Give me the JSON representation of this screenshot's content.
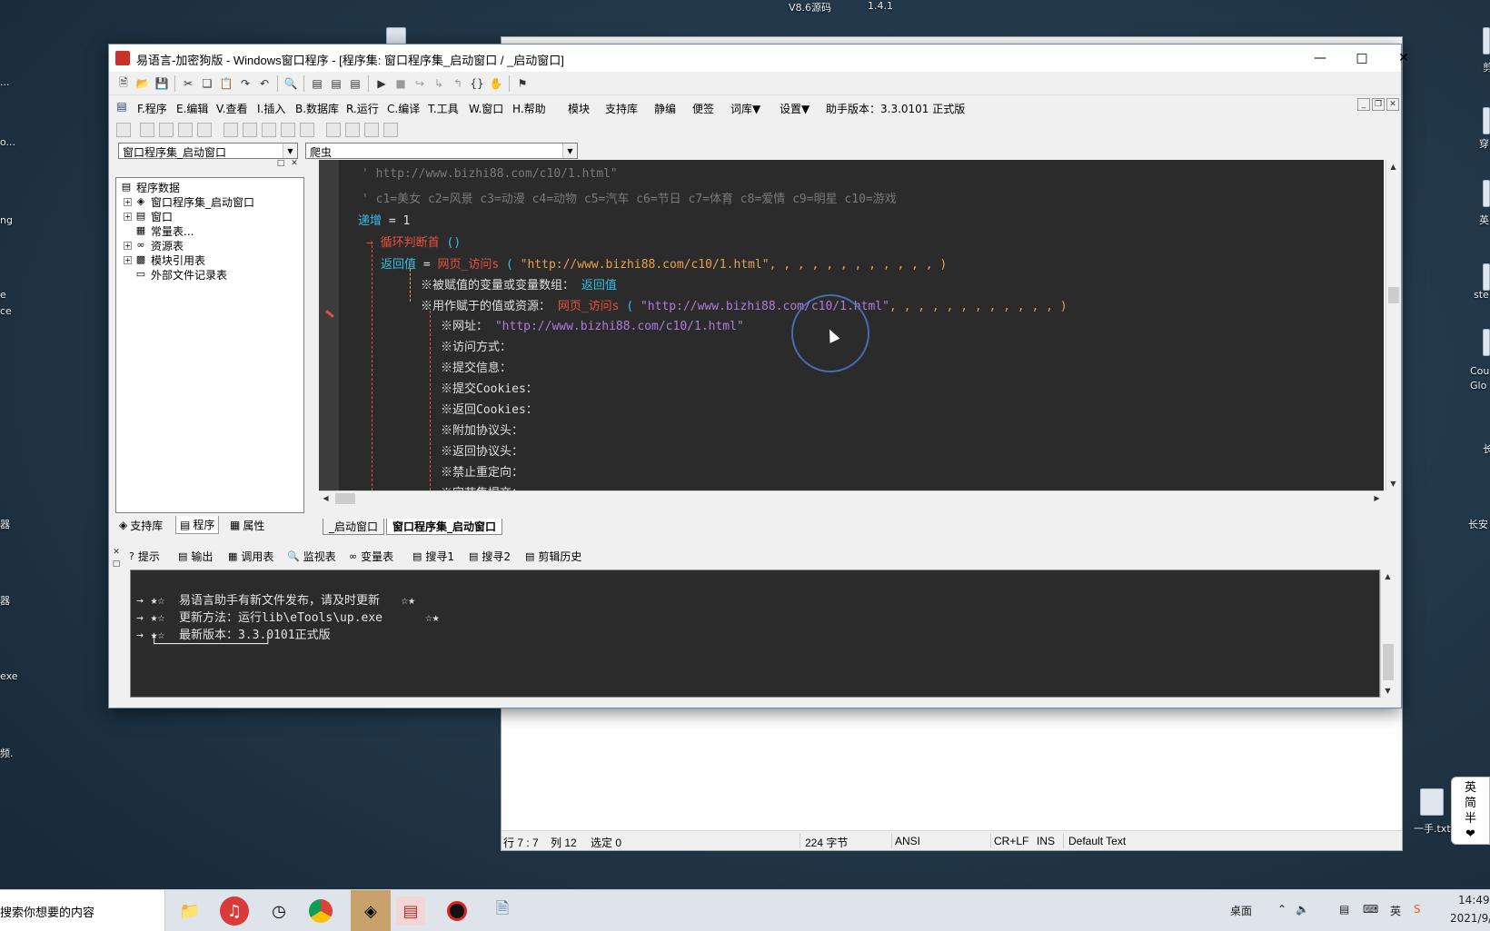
{
  "top_desktop": {
    "label1": "V8.6源码",
    "label2": "1.4.1"
  },
  "desktop_left_labels": [
    "...",
    "o...",
    "ng",
    "e",
    "ce",
    "器",
    "器",
    "exe",
    "频."
  ],
  "desktop_right_labels": [
    "剪",
    "穿",
    "英",
    "ste",
    "Cou",
    "Glo",
    "长",
    "长安",
    "一手.txt"
  ],
  "ime": [
    "英",
    "简",
    "半",
    "❤"
  ],
  "ide": {
    "title": "易语言-加密狗版 - Windows窗口程序 - [程序集: 窗口程序集_启动窗口 / _启动窗口]",
    "menu": [
      {
        "key": "F",
        "label": "F.程序"
      },
      {
        "key": "E",
        "label": "E.编辑"
      },
      {
        "key": "V",
        "label": "V.查看"
      },
      {
        "key": "I",
        "label": "I.插入"
      },
      {
        "key": "B",
        "label": "B.数据库"
      },
      {
        "key": "R",
        "label": "R.运行"
      },
      {
        "key": "C",
        "label": "C.编译"
      },
      {
        "key": "T",
        "label": "T.工具"
      },
      {
        "key": "W",
        "label": "W.窗口"
      },
      {
        "key": "H",
        "label": "H.帮助"
      }
    ],
    "menu_extra": [
      "模块",
      "支持库",
      "静编",
      "便签",
      "词库▼",
      "设置▼",
      "助手版本：3.3.0101 正式版"
    ],
    "combo_left": "窗口程序集_启动窗口",
    "combo_right": "爬虫",
    "tree": [
      {
        "label": "程序数据",
        "pm": "",
        "icon": "program-data-icon"
      },
      {
        "label": "窗口程序集_启动窗口",
        "pm": "+",
        "icon": "assembly-icon"
      },
      {
        "label": "窗口",
        "pm": "+",
        "icon": "window-icon"
      },
      {
        "label": "常量表...",
        "pm": "",
        "icon": "constant-icon"
      },
      {
        "label": "资源表",
        "pm": "+",
        "icon": "resource-icon"
      },
      {
        "label": "模块引用表",
        "pm": "+",
        "icon": "module-icon"
      },
      {
        "label": "外部文件记录表",
        "pm": "",
        "icon": "file-icon"
      }
    ],
    "left_tabs": [
      "支持库",
      "程序",
      "属性"
    ],
    "code": {
      "line1": "' http://www.bizhi88.com/c10/1.html\"",
      "line2": "' c1=美女 c2=风景 c3=动漫 c4=动物 c5=汽车 c6=节日 c7=体育 c8=爱情 c9=明星 c10=游戏",
      "l3_kw": "递增",
      "l3_rest": " = 1",
      "l4_fn": "循环判断首",
      "l4_rest": " ()",
      "l5_kw": "返回值",
      "l5_eq": " = ",
      "l5_fn": "网页_访问s",
      "l5_open": " (",
      "l5_str": "\"http://www.bizhi88.com/c10/1.html\"",
      "l5_tail": ", , , , , , , , , , , , )",
      "l6_label": "※被赋值的变量或变量数组：",
      "l6_val": "返回值",
      "l7_label": "※用作赋于的值或资源：",
      "l7_fn": "网页_访问s",
      "l7_open": " (",
      "l7_str": "\"http://www.bizhi88.com/c10/1.html\"",
      "l7_tail": ", , , , , , , , , , , , )",
      "l8_label": "※网址：",
      "l8_val": "\"http://www.bizhi88.com/c10/1.html\"",
      "params": [
        "※访问方式：",
        "※提交信息：",
        "※提交Cookies：",
        "※返回Cookies：",
        "※附加协议头：",
        "※返回协议头：",
        "※禁止重定向：",
        "※字节集提交："
      ]
    },
    "file_tabs": [
      "_启动窗口",
      "窗口程序集_启动窗口"
    ],
    "output_tabs": [
      "提示",
      "输出",
      "调用表",
      "监视表",
      "变量表",
      "搜寻1",
      "搜寻2",
      "剪辑历史"
    ],
    "output_lines": [
      "→ ★☆  易语言助手有新文件发布，请及时更新   ☆★",
      "→ ★☆  更新方法：运行lib\\eTools\\up.exe      ☆★",
      "→ ★☆  最新版本：3.3.0101正式版",
      "  └───────────────┘"
    ]
  },
  "notepad_status": {
    "pos": "行 7 : 7",
    "col": "列 12",
    "sel": "选定 0",
    "bytes": "224 字节",
    "enc": "ANSI",
    "eol": "CR+LF",
    "ins": "INS",
    "style": "Default Text"
  },
  "taskbar": {
    "search": "搜索你想要的内容",
    "desktop": "桌面",
    "time": "14:49",
    "date": "2021/9/"
  }
}
